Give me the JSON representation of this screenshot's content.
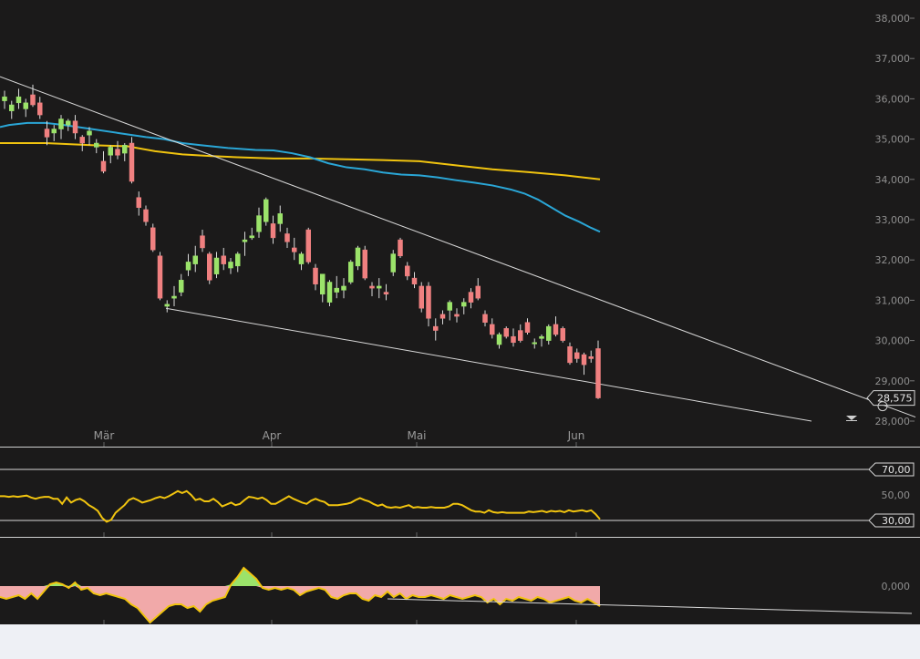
{
  "chart_data": [
    {
      "type": "candlestick",
      "title": "",
      "y_ticks": [
        "38,000",
        "37,000",
        "36,000",
        "35,000",
        "34,000",
        "33,000",
        "32,000",
        "31,000",
        "30,000",
        "29,000",
        "28,000"
      ],
      "x_ticks": [
        "Mär",
        "Apr",
        "Mai",
        "Jun"
      ],
      "ylim": [
        27.7,
        38.4
      ],
      "last_value": 28.575,
      "last_label": "28,575",
      "candles": [
        [
          35.95,
          36.2,
          35.75,
          36.05
        ],
        [
          35.7,
          35.95,
          35.5,
          35.85
        ],
        [
          35.9,
          36.25,
          35.75,
          36.05
        ],
        [
          35.75,
          36.0,
          35.55,
          35.9
        ],
        [
          36.1,
          36.35,
          35.8,
          35.85
        ],
        [
          35.9,
          36.05,
          35.5,
          35.6
        ],
        [
          35.25,
          35.45,
          34.85,
          35.05
        ],
        [
          35.15,
          35.35,
          34.95,
          35.25
        ],
        [
          35.25,
          35.6,
          35.0,
          35.5
        ],
        [
          35.35,
          35.5,
          35.2,
          35.45
        ],
        [
          35.45,
          35.6,
          35.0,
          35.15
        ],
        [
          35.05,
          35.1,
          34.7,
          34.9
        ],
        [
          35.1,
          35.3,
          34.85,
          35.2
        ],
        [
          34.8,
          35.0,
          34.65,
          34.9
        ],
        [
          34.45,
          34.7,
          34.15,
          34.2
        ],
        [
          34.6,
          34.85,
          34.4,
          34.8
        ],
        [
          34.75,
          34.95,
          34.5,
          34.6
        ],
        [
          34.65,
          34.9,
          34.45,
          34.85
        ],
        [
          34.9,
          35.05,
          33.9,
          33.95
        ],
        [
          33.55,
          33.7,
          33.1,
          33.3
        ],
        [
          33.25,
          33.35,
          32.85,
          32.95
        ],
        [
          32.8,
          32.9,
          32.2,
          32.25
        ],
        [
          32.1,
          32.2,
          31.0,
          31.05
        ],
        [
          30.85,
          31.0,
          30.7,
          30.9
        ],
        [
          31.05,
          31.35,
          30.85,
          31.1
        ],
        [
          31.2,
          31.65,
          31.1,
          31.5
        ],
        [
          31.75,
          32.15,
          31.6,
          31.95
        ],
        [
          31.9,
          32.35,
          31.7,
          32.1
        ],
        [
          32.6,
          32.75,
          32.2,
          32.3
        ],
        [
          32.15,
          32.2,
          31.4,
          31.5
        ],
        [
          31.65,
          32.2,
          31.55,
          32.05
        ],
        [
          32.1,
          32.3,
          31.75,
          31.9
        ],
        [
          31.8,
          32.05,
          31.65,
          31.95
        ],
        [
          31.85,
          32.2,
          31.7,
          32.15
        ],
        [
          32.45,
          32.7,
          32.1,
          32.5
        ],
        [
          32.55,
          32.8,
          32.5,
          32.6
        ],
        [
          32.7,
          33.3,
          32.55,
          33.1
        ],
        [
          32.95,
          33.55,
          32.85,
          33.5
        ],
        [
          32.9,
          33.1,
          32.4,
          32.55
        ],
        [
          32.9,
          33.35,
          32.7,
          33.15
        ],
        [
          32.65,
          32.8,
          32.3,
          32.45
        ],
        [
          32.3,
          32.55,
          32.0,
          32.2
        ],
        [
          31.9,
          32.2,
          31.75,
          32.15
        ],
        [
          32.75,
          32.8,
          31.9,
          31.95
        ],
        [
          31.8,
          31.9,
          31.25,
          31.4
        ],
        [
          31.15,
          31.6,
          30.95,
          31.65
        ],
        [
          30.95,
          31.5,
          30.85,
          31.45
        ],
        [
          31.2,
          31.6,
          31.05,
          31.3
        ],
        [
          31.25,
          31.55,
          31.05,
          31.35
        ],
        [
          31.45,
          32.0,
          31.4,
          31.95
        ],
        [
          31.85,
          32.35,
          31.75,
          32.3
        ],
        [
          32.25,
          32.35,
          31.5,
          31.55
        ],
        [
          31.35,
          31.45,
          31.1,
          31.3
        ],
        [
          31.3,
          31.55,
          31.05,
          31.35
        ],
        [
          31.2,
          31.4,
          31.0,
          31.15
        ],
        [
          31.7,
          32.25,
          31.6,
          32.15
        ],
        [
          32.5,
          32.55,
          32.05,
          32.1
        ],
        [
          31.85,
          31.95,
          31.5,
          31.6
        ],
        [
          31.55,
          31.7,
          31.3,
          31.4
        ],
        [
          31.35,
          31.45,
          30.7,
          30.8
        ],
        [
          31.35,
          31.45,
          30.35,
          30.55
        ],
        [
          30.35,
          30.55,
          30.0,
          30.25
        ],
        [
          30.65,
          30.75,
          30.4,
          30.55
        ],
        [
          30.75,
          31.0,
          30.5,
          30.95
        ],
        [
          30.65,
          30.8,
          30.45,
          30.6
        ],
        [
          30.85,
          31.05,
          30.65,
          30.95
        ],
        [
          31.2,
          31.3,
          30.8,
          30.95
        ],
        [
          31.35,
          31.55,
          31.0,
          31.05
        ],
        [
          30.65,
          30.75,
          30.35,
          30.45
        ],
        [
          30.4,
          30.55,
          30.05,
          30.15
        ],
        [
          29.9,
          30.2,
          29.8,
          30.15
        ],
        [
          30.3,
          30.35,
          30.05,
          30.1
        ],
        [
          30.1,
          30.3,
          29.85,
          29.95
        ],
        [
          30.25,
          30.4,
          29.95,
          30.0
        ],
        [
          30.45,
          30.55,
          30.15,
          30.2
        ],
        [
          29.95,
          30.05,
          29.8,
          29.95
        ],
        [
          30.05,
          30.15,
          29.85,
          30.1
        ],
        [
          30.0,
          30.4,
          29.9,
          30.35
        ],
        [
          30.4,
          30.6,
          30.1,
          30.15
        ],
        [
          30.3,
          30.35,
          29.95,
          30.0
        ],
        [
          29.85,
          29.95,
          29.4,
          29.45
        ],
        [
          29.7,
          29.8,
          29.45,
          29.55
        ],
        [
          29.65,
          29.7,
          29.15,
          29.4
        ],
        [
          29.6,
          29.75,
          29.45,
          29.55
        ],
        [
          29.8,
          30.0,
          28.55,
          28.575
        ]
      ],
      "sma_blue": [
        [
          0,
          35.3
        ],
        [
          10,
          35.35
        ],
        [
          30,
          35.4
        ],
        [
          50,
          35.4
        ],
        [
          70,
          35.35
        ],
        [
          100,
          35.25
        ],
        [
          130,
          35.15
        ],
        [
          160,
          35.05
        ],
        [
          180,
          35.0
        ],
        [
          200,
          34.9
        ],
        [
          220,
          34.85
        ],
        [
          250,
          34.78
        ],
        [
          280,
          34.73
        ],
        [
          300,
          34.72
        ],
        [
          320,
          34.65
        ],
        [
          340,
          34.55
        ],
        [
          360,
          34.4
        ],
        [
          380,
          34.3
        ],
        [
          400,
          34.25
        ],
        [
          420,
          34.17
        ],
        [
          440,
          34.12
        ],
        [
          460,
          34.1
        ],
        [
          480,
          34.05
        ],
        [
          500,
          33.98
        ],
        [
          520,
          33.92
        ],
        [
          540,
          33.85
        ],
        [
          560,
          33.75
        ],
        [
          575,
          33.65
        ],
        [
          590,
          33.5
        ],
        [
          605,
          33.3
        ],
        [
          620,
          33.1
        ],
        [
          635,
          32.95
        ],
        [
          648,
          32.8
        ],
        [
          658,
          32.7
        ]
      ],
      "sma_yellow": [
        [
          0,
          34.9
        ],
        [
          50,
          34.9
        ],
        [
          100,
          34.85
        ],
        [
          140,
          34.82
        ],
        [
          170,
          34.7
        ],
        [
          200,
          34.62
        ],
        [
          230,
          34.58
        ],
        [
          260,
          34.55
        ],
        [
          300,
          34.52
        ],
        [
          340,
          34.52
        ],
        [
          380,
          34.5
        ],
        [
          420,
          34.48
        ],
        [
          460,
          34.45
        ],
        [
          500,
          34.35
        ],
        [
          540,
          34.25
        ],
        [
          580,
          34.18
        ],
        [
          620,
          34.1
        ],
        [
          658,
          34.0
        ]
      ],
      "trendlines": [
        {
          "from": [
            0,
            36.55
          ],
          "to": [
            1004,
            28.1
          ]
        },
        {
          "from": [
            182,
            30.8
          ],
          "to": [
            890,
            28.0
          ]
        }
      ],
      "legend_marker": "downward-triangle-icon"
    },
    {
      "type": "line",
      "title": "",
      "y_ticks": [
        "70,00",
        "50,00",
        "30,00"
      ],
      "levels": [
        70,
        30
      ],
      "level_labels": [
        "70,00",
        "30,00"
      ],
      "ylim": [
        30,
        70
      ],
      "values": [
        49,
        49,
        48.5,
        49,
        48.5,
        49,
        49.5,
        48,
        47,
        48,
        48.5,
        48.5,
        47,
        47,
        43,
        48,
        44,
        46,
        47,
        45,
        42,
        40,
        37.5,
        32,
        29,
        30.5,
        36,
        39,
        42,
        46,
        47.5,
        46,
        44,
        45,
        46,
        47.5,
        48.5,
        47.5,
        49,
        51,
        53,
        51.5,
        53,
        50,
        46,
        47,
        45,
        45,
        47,
        44.5,
        41,
        42.5,
        44,
        42,
        43,
        46,
        48.5,
        48,
        47,
        48,
        46,
        43,
        43,
        45,
        47,
        49,
        47,
        45.5,
        44,
        43,
        45.5,
        47,
        45.5,
        44.5,
        42,
        42,
        42,
        42.5,
        43,
        44,
        46,
        47.5,
        46,
        45,
        43,
        41.5,
        42.5,
        40.5,
        40,
        40.5,
        40,
        41,
        42,
        40,
        40.5,
        40,
        40,
        40.5,
        40,
        40,
        40,
        41,
        43,
        43,
        42,
        40,
        38,
        37,
        37,
        36,
        38,
        36.5,
        36,
        36.5,
        36,
        36,
        36,
        36,
        36,
        37,
        36.5,
        37,
        37.5,
        36.5,
        37.5,
        37,
        37.5,
        36.5,
        38,
        37,
        37.5,
        38,
        37,
        38,
        35,
        31
      ],
      "color": "#f1c40f"
    },
    {
      "type": "area",
      "title": "",
      "y_ticks": [
        "0,000"
      ],
      "ylim": [
        -1,
        1
      ],
      "values": [
        -0.3,
        -0.35,
        -0.3,
        -0.25,
        -0.35,
        -0.2,
        -0.35,
        -0.15,
        0.05,
        0.1,
        0.05,
        -0.05,
        0.1,
        -0.1,
        -0.05,
        -0.2,
        -0.25,
        -0.2,
        -0.25,
        -0.3,
        -0.35,
        -0.5,
        -0.6,
        -0.8,
        -1.0,
        -0.85,
        -0.7,
        -0.55,
        -0.5,
        -0.5,
        -0.6,
        -0.55,
        -0.7,
        -0.5,
        -0.4,
        -0.35,
        -0.3,
        0.05,
        0.25,
        0.5,
        0.35,
        0.2,
        -0.05,
        -0.1,
        -0.05,
        -0.1,
        -0.05,
        -0.1,
        -0.25,
        -0.15,
        -0.1,
        -0.05,
        -0.1,
        -0.3,
        -0.35,
        -0.25,
        -0.2,
        -0.2,
        -0.35,
        -0.4,
        -0.25,
        -0.3,
        -0.15,
        -0.3,
        -0.2,
        -0.35,
        -0.25,
        -0.3,
        -0.3,
        -0.25,
        -0.3,
        -0.35,
        -0.25,
        -0.3,
        -0.35,
        -0.3,
        -0.25,
        -0.3,
        -0.45,
        -0.35,
        -0.5,
        -0.35,
        -0.4,
        -0.3,
        -0.35,
        -0.4,
        -0.3,
        -0.35,
        -0.45,
        -0.4,
        -0.35,
        -0.3,
        -0.4,
        -0.45,
        -0.35,
        -0.45,
        -0.55
      ],
      "trendline": {
        "from": [
          425,
          -0.35
        ],
        "to": [
          1000,
          -0.75
        ]
      }
    }
  ]
}
